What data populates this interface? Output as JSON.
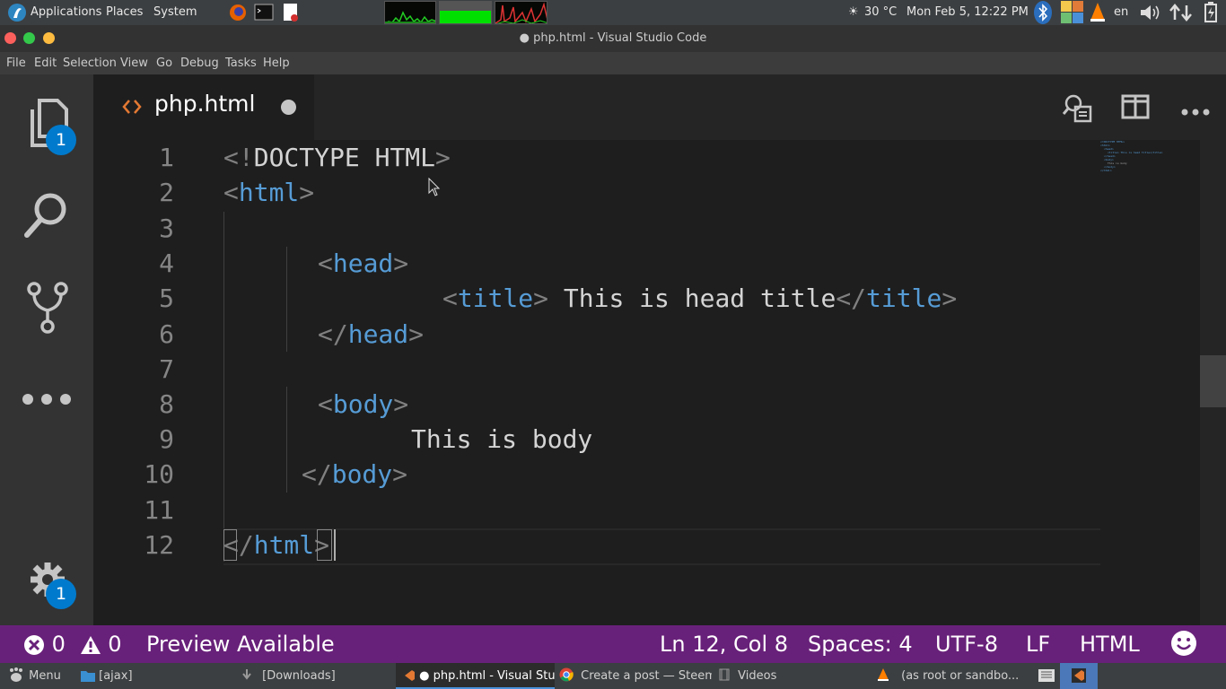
{
  "top_panel": {
    "menus": [
      "Applications",
      "Places",
      "System"
    ],
    "weather": "30 °C",
    "clock": "Mon Feb  5, 12:22 PM",
    "keyboard_layout": "en"
  },
  "window": {
    "title": "● php.html - Visual Studio Code"
  },
  "menubar": [
    "File",
    "Edit",
    "Selection",
    "View",
    "Go",
    "Debug",
    "Tasks",
    "Help"
  ],
  "activity_bar": {
    "explorer_badge": "1",
    "settings_badge": "1"
  },
  "tab": {
    "filename": "php.html",
    "icon": "html-brackets-icon",
    "dirty": true
  },
  "editor": {
    "lines": [
      {
        "n": "1",
        "text": "<!DOCTYPE HTML>"
      },
      {
        "n": "2",
        "text": "<html>"
      },
      {
        "n": "3",
        "text": ""
      },
      {
        "n": "4",
        "text": "<head>"
      },
      {
        "n": "5",
        "text": "<title> This is head title</title>"
      },
      {
        "n": "6",
        "text": "</head>"
      },
      {
        "n": "7",
        "text": ""
      },
      {
        "n": "8",
        "text": "<body>"
      },
      {
        "n": "9",
        "text": "This is body"
      },
      {
        "n": "10",
        "text": "</body>"
      },
      {
        "n": "11",
        "text": ""
      },
      {
        "n": "12",
        "text": "</html>"
      }
    ],
    "minimap_lines": [
      "<!DOCTYPE HTML>",
      "<html>",
      "<head>",
      "<title> This is head title</title>",
      "</head>",
      "<body>",
      "This is body",
      "</body>",
      "</html>"
    ]
  },
  "statusbar": {
    "errors": "0",
    "warnings": "0",
    "preview": "Preview Available",
    "position": "Ln 12, Col 8",
    "spaces": "Spaces: 4",
    "encoding": "UTF-8",
    "eol": "LF",
    "language": "HTML"
  },
  "taskbar": {
    "menu": "Menu",
    "items": [
      {
        "label": "[ajax]"
      },
      {
        "label": "[Downloads]"
      },
      {
        "label": "● php.html - Visual Stu..."
      },
      {
        "label": "Create a post — Steem..."
      },
      {
        "label": "Videos"
      },
      {
        "label": "(as root or sandbo..."
      }
    ]
  },
  "colors": {
    "statusbar": "#68217a",
    "badge": "#007acc",
    "tag": "#569cd6"
  }
}
